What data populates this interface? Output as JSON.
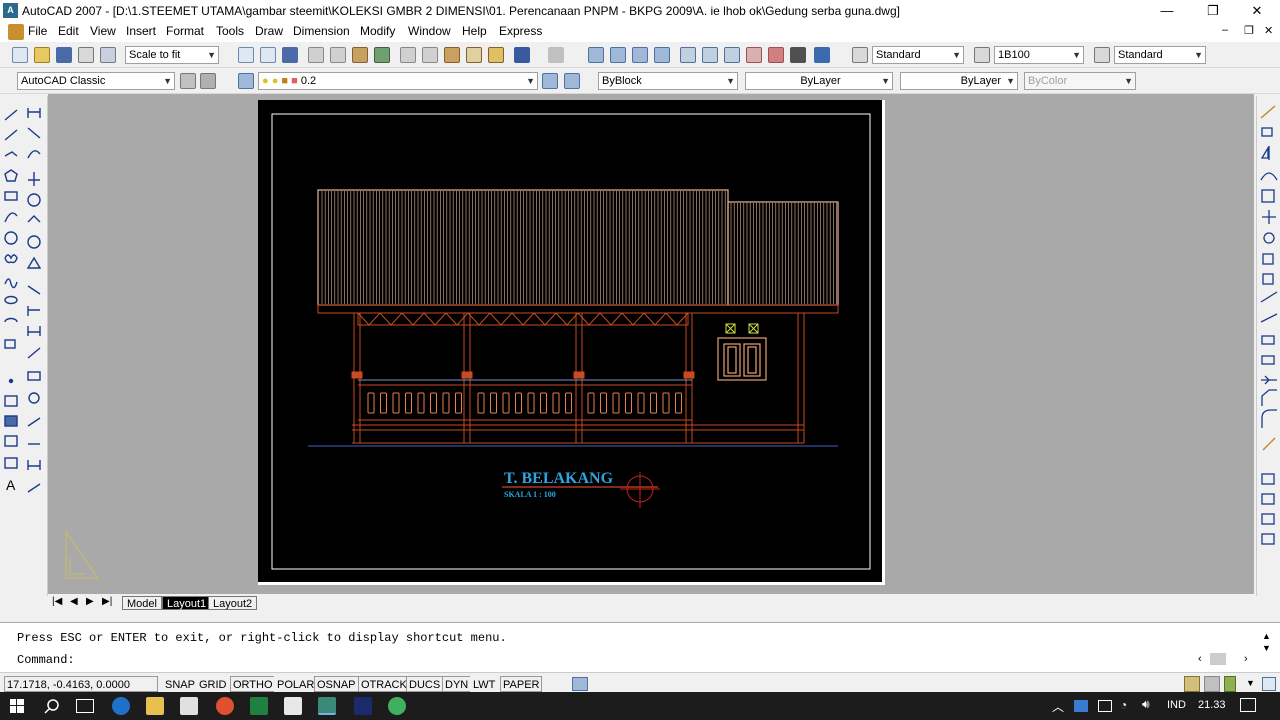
{
  "window": {
    "title": "AutoCAD 2007 - [D:\\1.STEEMET UTAMA\\gambar steemit\\KOLEKSI GMBR 2 DIMENSI\\01. Perencanaan PNPM - BKPG 2009\\A. ie lhob ok\\Gedung serba guna.dwg]",
    "app_icon": "A",
    "minimize_glyph": "—",
    "restore_glyph": "❐",
    "close_glyph": "✕"
  },
  "menu": [
    "File",
    "Edit",
    "View",
    "Insert",
    "Format",
    "Tools",
    "Draw",
    "Dimension",
    "Modify",
    "Window",
    "Help",
    "Express"
  ],
  "toolbar": {
    "zoom_value": "Scale to fit",
    "text_style": "Standard",
    "dim_style": "1B100",
    "table_style": "Standard",
    "workspace": "AutoCAD Classic",
    "layer": "0.2",
    "color": "ByBlock",
    "linetype": "ByLayer",
    "lineweight": "ByLayer",
    "plotstyle": "ByColor"
  },
  "drawing": {
    "title": "T. BELAKANG",
    "scale": "SKALA  1 : 100"
  },
  "tabs": [
    "Model",
    "Layout1",
    "Layout2"
  ],
  "active_tab": "Layout1",
  "command": {
    "history": "Press ESC or ENTER to exit, or right-click to display shortcut menu.",
    "prompt": "Command:"
  },
  "status": {
    "coords": "17.1718, -0.4163, 0.0000",
    "buttons": [
      "SNAP",
      "GRID",
      "ORTHO",
      "POLAR",
      "OSNAP",
      "OTRACK",
      "DUCS",
      "DYN",
      "LWT",
      "PAPER"
    ]
  },
  "taskbar": {
    "language": "IND",
    "time": "21.33"
  },
  "colors": {
    "roof": "#e8b89a",
    "structure": "#c84a20",
    "window_frame": "#e8a070",
    "title_text": "#2aa6e0",
    "ground_line": "#4060c0"
  }
}
